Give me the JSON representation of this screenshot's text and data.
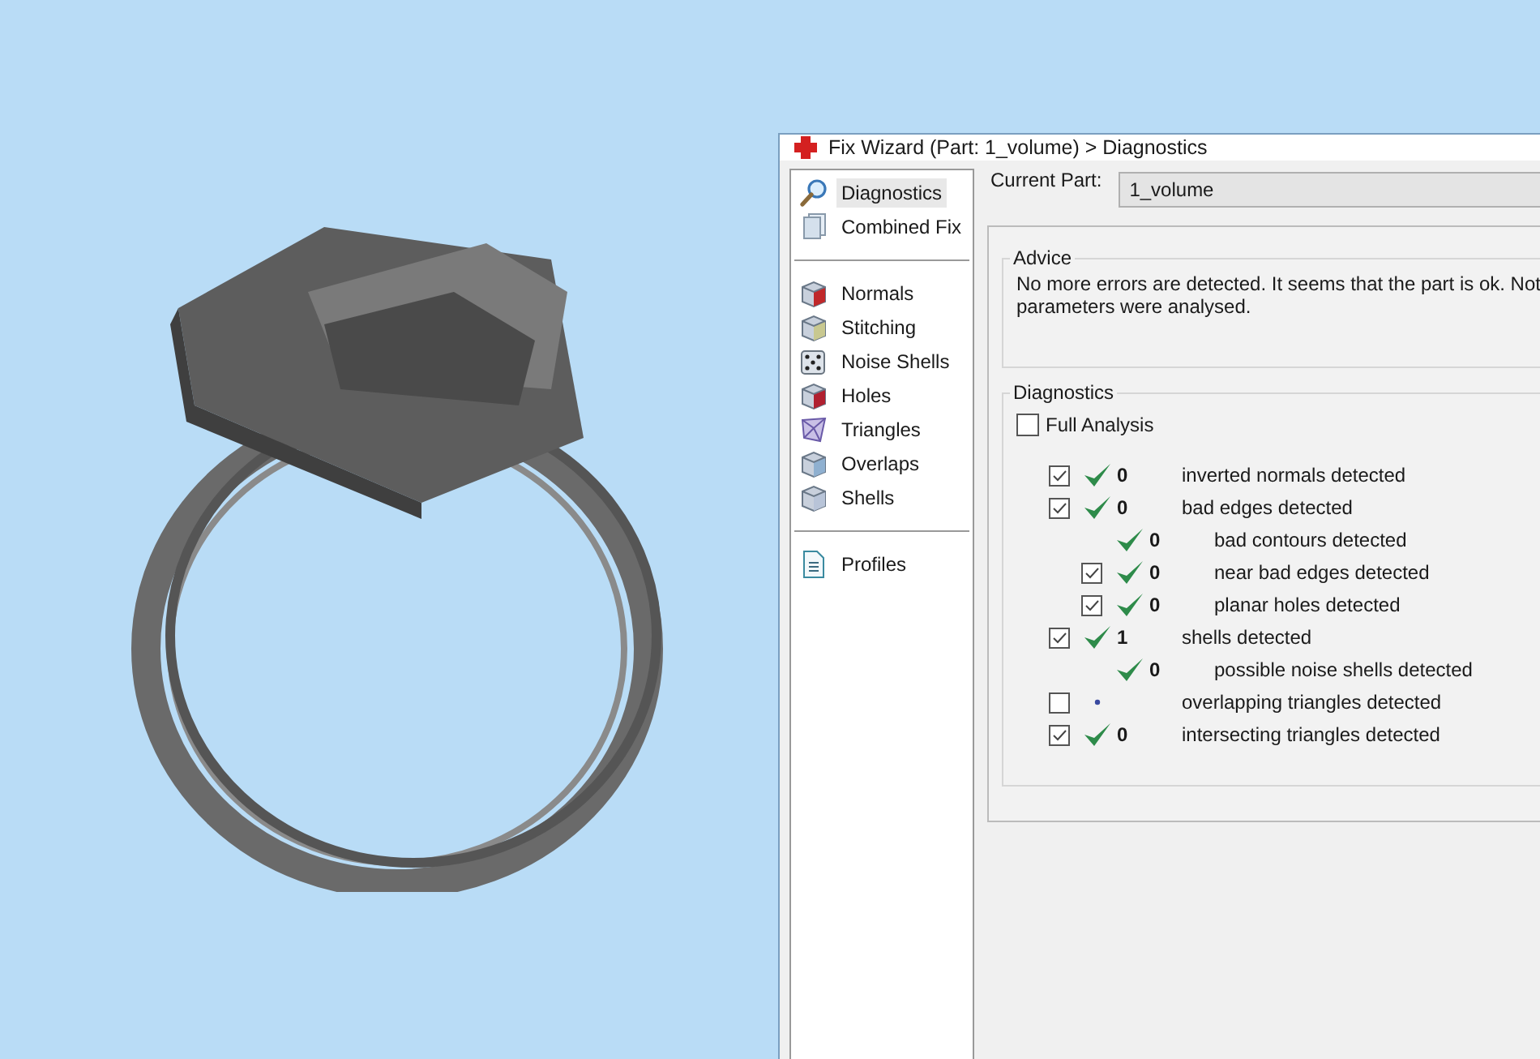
{
  "window": {
    "title": "Fix Wizard (Part: 1_volume) > Diagnostics"
  },
  "sidebar": {
    "groups": [
      [
        {
          "label": "Diagnostics",
          "selected": true
        },
        {
          "label": "Combined Fix",
          "selected": false
        }
      ],
      [
        {
          "label": "Normals",
          "selected": false
        },
        {
          "label": "Stitching",
          "selected": false
        },
        {
          "label": "Noise Shells",
          "selected": false
        },
        {
          "label": "Holes",
          "selected": false
        },
        {
          "label": "Triangles",
          "selected": false
        },
        {
          "label": "Overlaps",
          "selected": false
        },
        {
          "label": "Shells",
          "selected": false
        }
      ],
      [
        {
          "label": "Profiles",
          "selected": false
        }
      ]
    ]
  },
  "current_part": {
    "label": "Current Part:",
    "value": "1_volume"
  },
  "advice": {
    "title": "Advice",
    "text": "No more errors are detected. It seems that the part is ok. Not\nparameters were analysed."
  },
  "diagnostics": {
    "title": "Diagnostics",
    "full_analysis": {
      "label": "Full Analysis",
      "checked": false
    },
    "rows": [
      {
        "kind": "toggle",
        "checked": true,
        "passed": true,
        "count": "0",
        "label": "inverted normals detected"
      },
      {
        "kind": "toggle",
        "checked": true,
        "passed": true,
        "count": "0",
        "label": "bad edges detected",
        "children": [
          {
            "kind": "plain",
            "passed": true,
            "count": "0",
            "label": "bad contours detected"
          },
          {
            "kind": "toggle",
            "checked": true,
            "passed": true,
            "count": "0",
            "label": "near bad edges detected"
          },
          {
            "kind": "toggle",
            "checked": true,
            "passed": true,
            "count": "0",
            "label": "planar holes detected"
          }
        ]
      },
      {
        "kind": "toggle",
        "checked": true,
        "passed": true,
        "count": "1",
        "label": "shells detected",
        "children": [
          {
            "kind": "plain",
            "passed": true,
            "count": "0",
            "label": "possible noise shells detected"
          }
        ]
      },
      {
        "kind": "toggle",
        "checked": false,
        "passed": false,
        "label": "overlapping triangles detected"
      },
      {
        "kind": "toggle",
        "checked": true,
        "passed": true,
        "count": "0",
        "label": "intersecting triangles detected"
      }
    ]
  }
}
